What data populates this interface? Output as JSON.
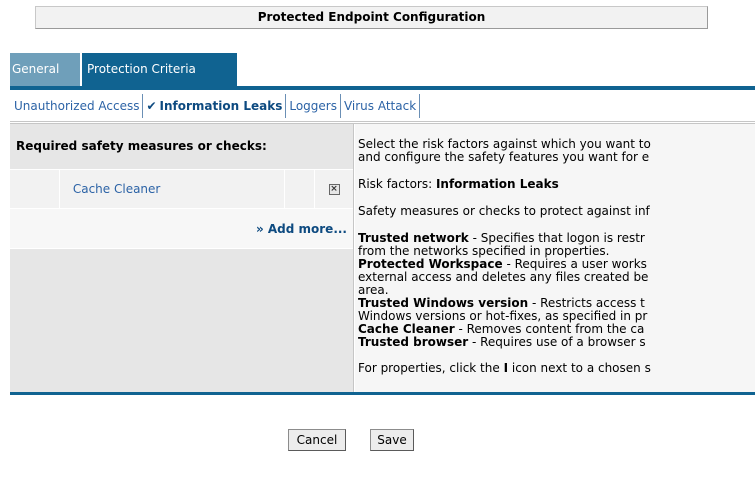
{
  "window": {
    "title": "Protected Endpoint Configuration"
  },
  "tabs": [
    {
      "label": "General"
    },
    {
      "label": "Protection Criteria"
    }
  ],
  "subtabs": [
    {
      "label": "Unauthorized Access"
    },
    {
      "label": "Information Leaks",
      "checkmark": "✔"
    },
    {
      "label": "Loggers"
    },
    {
      "label": "Virus Attack"
    }
  ],
  "left_panel": {
    "header": "Required safety measures or checks:",
    "items": [
      {
        "name": "Cache Cleaner",
        "delete_icon": "close-box-icon"
      }
    ],
    "add_more": "» Add more..."
  },
  "right_panel": {
    "intro_line1": "Select the risk factors against which you want to",
    "intro_line2": "and configure the safety features you want for e",
    "risk_label": "Risk factors: ",
    "risk_value": "Information Leaks",
    "safety_line": "Safety measures or checks to protect against inf",
    "trusted_network_title": "Trusted network",
    "trusted_network_l1": " - Specifies that logon is restr",
    "trusted_network_l2": "from the networks specified in properties.",
    "protected_ws_title": "Protected Workspace",
    "protected_ws_l1": " - Requires a user works",
    "protected_ws_l2": "external access and deletes any files created be",
    "protected_ws_l3": "area.",
    "trusted_win_title": "Trusted Windows version",
    "trusted_win_l1": " - Restricts access t",
    "trusted_win_l2": "Windows versions or hot-fixes, as specified in pr",
    "cache_title": "Cache Cleaner",
    "cache_l1": " - Removes content from the ca",
    "browser_title": "Trusted browser",
    "browser_l1": " - Requires use of a browser s",
    "props_pre": "For properties, click the ",
    "props_icon": "I",
    "props_post": " icon next to a chosen s"
  },
  "buttons": {
    "cancel": "Cancel",
    "save": "Save"
  }
}
